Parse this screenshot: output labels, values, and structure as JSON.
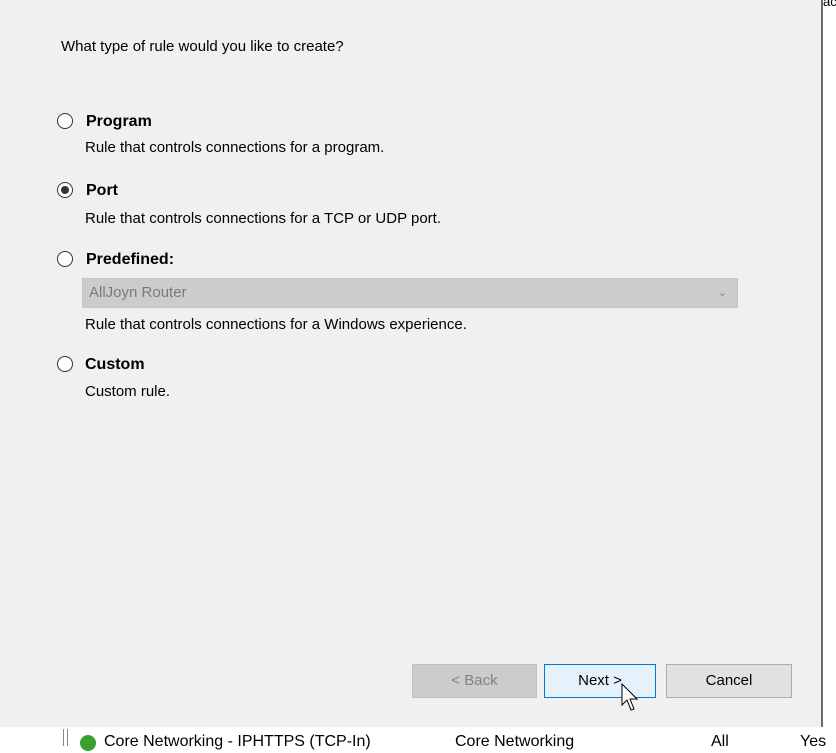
{
  "question": "What type of rule would you like to create?",
  "options": [
    {
      "label": "Program",
      "description": "Rule that controls connections for a program.",
      "checked": false
    },
    {
      "label": "Port",
      "description": "Rule that controls connections for a TCP or UDP port.",
      "checked": true
    },
    {
      "label": "Predefined:",
      "description": "Rule that controls connections for a Windows experience.",
      "checked": false
    },
    {
      "label": "Custom",
      "description": "Custom rule.",
      "checked": false
    }
  ],
  "predefined_select": {
    "value": "AllJoyn Router",
    "icon": "chevron-down-icon"
  },
  "buttons": {
    "back": "< Back",
    "next": "Next >",
    "cancel": "Cancel"
  },
  "background_peek": "ac",
  "background_row": {
    "name": "Core Networking - IPHTTPS (TCP-In)",
    "group": "Core Networking",
    "profile": "All",
    "enabled": "Yes"
  }
}
